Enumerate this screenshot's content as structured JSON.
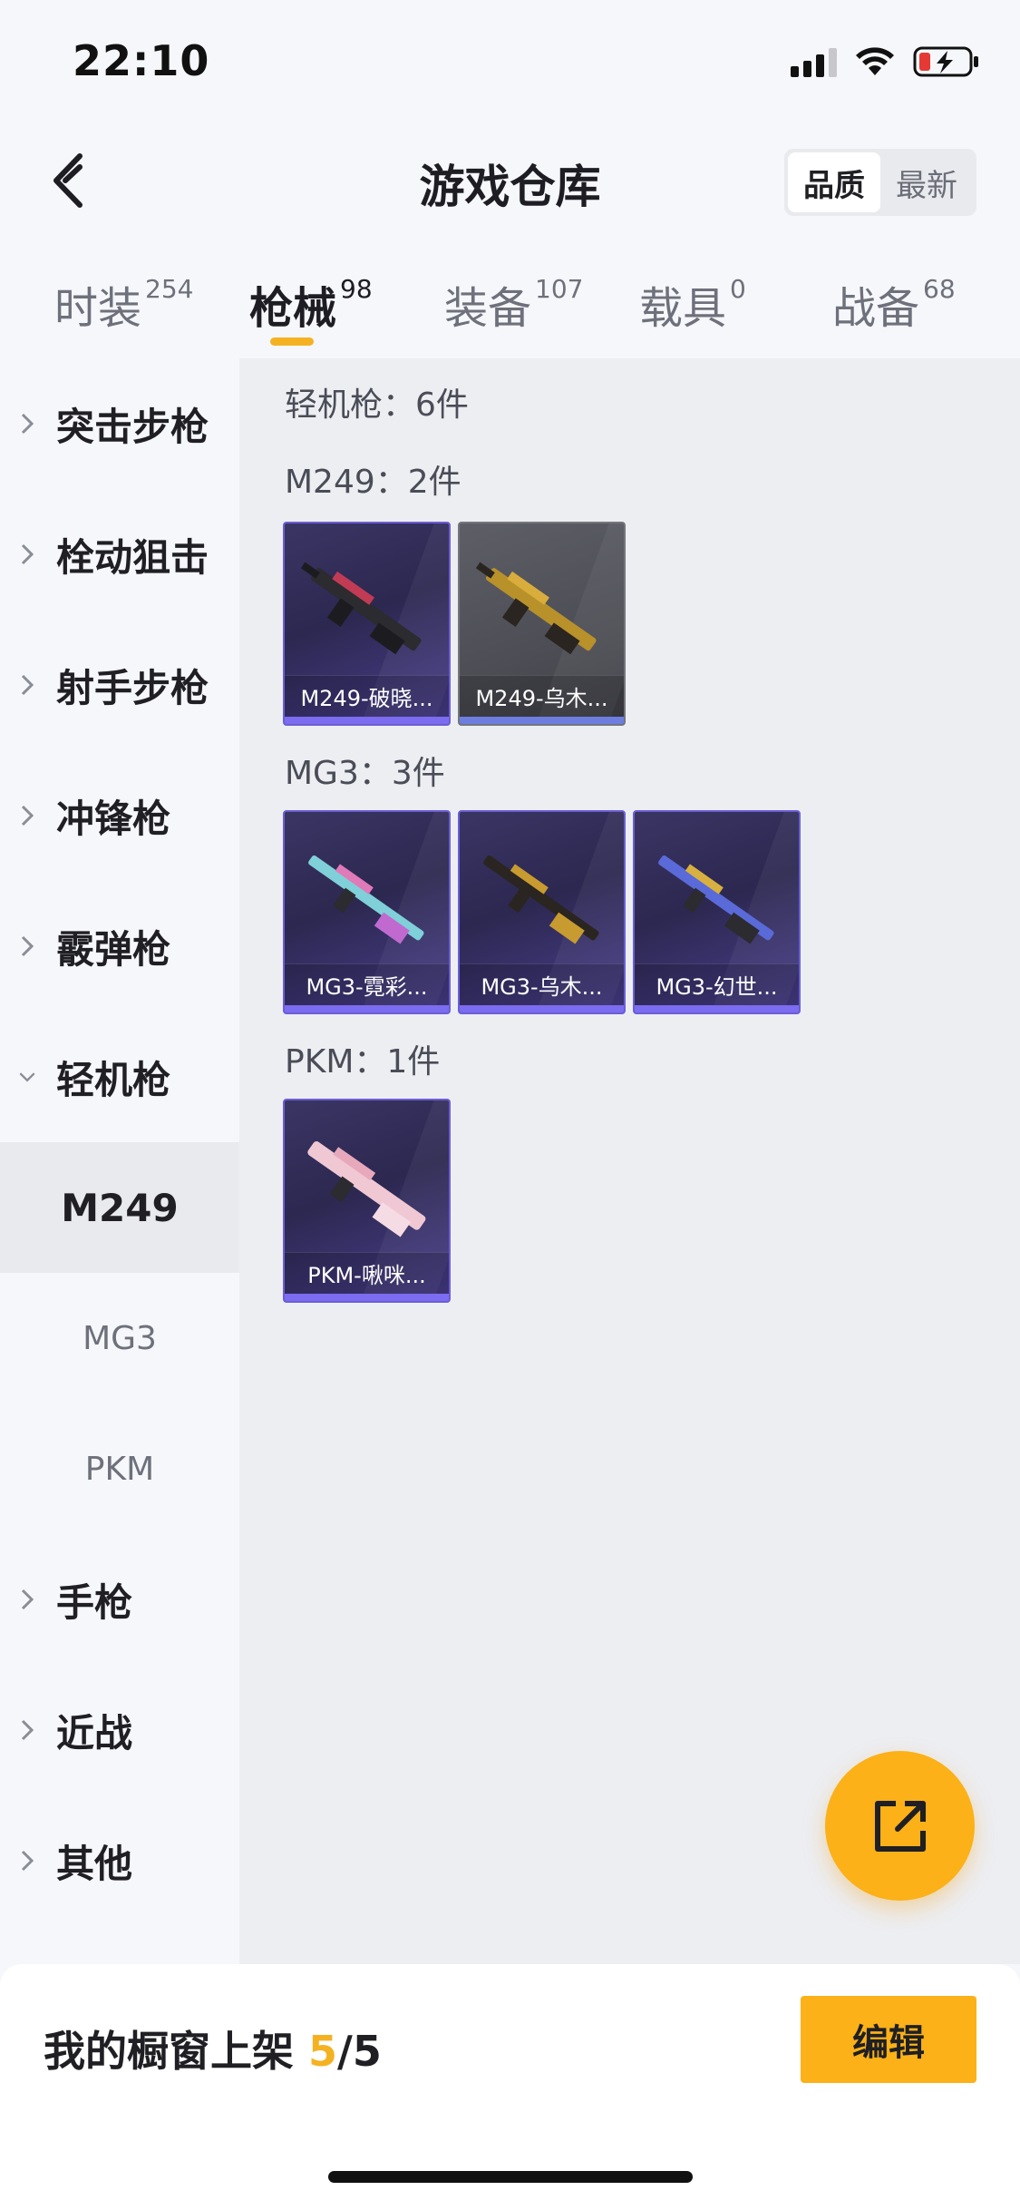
{
  "status_bar": {
    "time": "22:10"
  },
  "header": {
    "title": "游戏仓库",
    "sort_options": [
      "品质",
      "最新"
    ],
    "sort_active": "品质"
  },
  "tabs": [
    {
      "label": "时装",
      "count": "254"
    },
    {
      "label": "枪械",
      "count": "98"
    },
    {
      "label": "装备",
      "count": "107"
    },
    {
      "label": "载具",
      "count": "0"
    },
    {
      "label": "战备",
      "count": "68"
    }
  ],
  "active_tab": "枪械",
  "sidebar": {
    "categories": [
      {
        "label": "突击步枪"
      },
      {
        "label": "栓动狙击"
      },
      {
        "label": "射手步枪"
      },
      {
        "label": "冲锋枪"
      },
      {
        "label": "霰弹枪"
      },
      {
        "label": "轻机枪"
      },
      {
        "label": "手枪"
      },
      {
        "label": "近战"
      },
      {
        "label": "其他"
      }
    ],
    "subcategories": [
      {
        "label": "M249"
      },
      {
        "label": "MG3"
      },
      {
        "label": "PKM"
      }
    ],
    "active_sub": "M249"
  },
  "content": {
    "category_summary": "轻机枪：6件",
    "groups": [
      {
        "heading": "M249：2件",
        "items": [
          "M249-破晓...",
          "M249-乌木..."
        ]
      },
      {
        "heading": "MG3：3件",
        "items": [
          "MG3-霓彩...",
          "MG3-乌木...",
          "MG3-幻世..."
        ]
      },
      {
        "heading": "PKM：1件",
        "items": [
          "PKM-啾咪..."
        ]
      }
    ]
  },
  "footer": {
    "shelf_label": "我的橱窗上架",
    "shelf_current": "5",
    "shelf_total": "/5",
    "edit_label": "编辑"
  },
  "colors": {
    "accent": "#fbb117",
    "rare_purple": "#6b5ed6"
  },
  "icons": {
    "back": "chevron-left-icon",
    "share": "external-link-icon",
    "expand": "chevron-right-icon",
    "collapse": "chevron-down-icon"
  }
}
